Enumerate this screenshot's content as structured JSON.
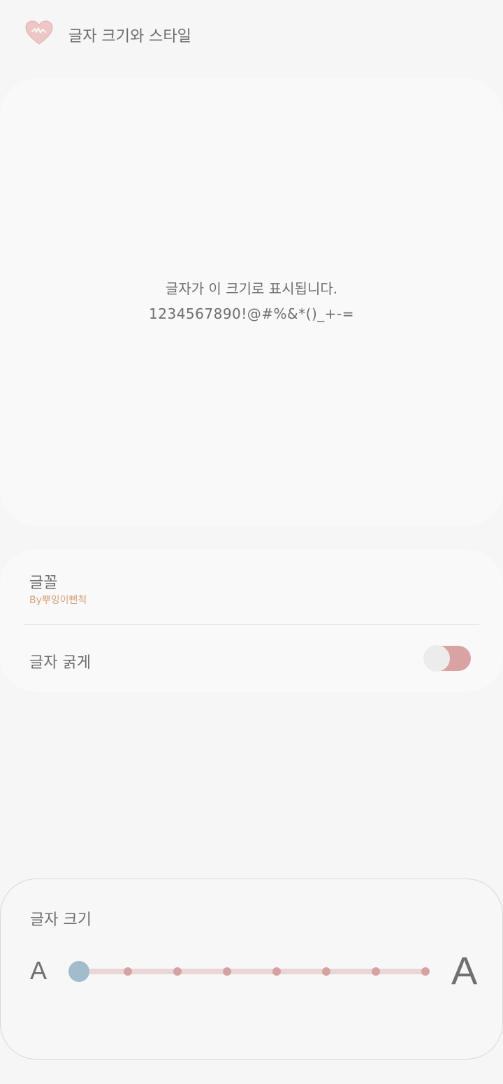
{
  "header": {
    "title": "글자 크기와 스타일",
    "back_icon": "heart-icon",
    "back_icon_color": "#e8bcbc"
  },
  "preview": {
    "line1": "글자가 이 크기로 표시됩니다.",
    "line2": "1234567890!@#%&*()_+-="
  },
  "settings": {
    "font": {
      "label": "글꼴",
      "value": "By뿌잉이뻔척"
    },
    "bold": {
      "label": "글자 굵게",
      "enabled": false
    }
  },
  "font_size": {
    "label": "글자 크기",
    "small_label": "A",
    "large_label": "A",
    "steps": 8,
    "current_step": 1
  },
  "colors": {
    "accent_pink": "#d9a3a3",
    "slider_thumb": "#a3bccc",
    "font_value": "#d6a27a",
    "background": "#f6f6f6"
  }
}
